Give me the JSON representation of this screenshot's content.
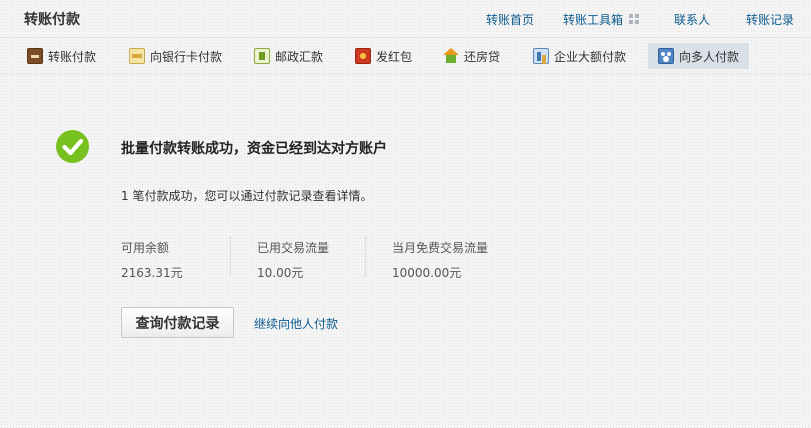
{
  "header": {
    "title": "转账付款",
    "links": {
      "home": "转账首页",
      "toolbox": "转账工具箱",
      "contacts": "联系人",
      "records": "转账记录"
    }
  },
  "tabs": [
    {
      "label": "转账付款",
      "icon": "transfer-icon"
    },
    {
      "label": "向银行卡付款",
      "icon": "bank-card-icon"
    },
    {
      "label": "邮政汇款",
      "icon": "postal-icon"
    },
    {
      "label": "发红包",
      "icon": "red-packet-icon"
    },
    {
      "label": "还房贷",
      "icon": "house-icon"
    },
    {
      "label": "企业大额付款",
      "icon": "enterprise-icon"
    },
    {
      "label": "向多人付款",
      "icon": "multi-payee-icon",
      "active": true
    }
  ],
  "result": {
    "title": "批量付款转账成功，资金已经到达对方账户",
    "detail": "1 笔付款成功，您可以通过付款记录查看详情。"
  },
  "stats": [
    {
      "label": "可用余额",
      "value": "2163.31元"
    },
    {
      "label": "已用交易流量",
      "value": "10.00元"
    },
    {
      "label": "当月免费交易流量",
      "value": "10000.00元"
    }
  ],
  "actions": {
    "primary": "查询付款记录",
    "secondary": "继续向他人付款"
  },
  "colors": {
    "link": "#0e5c8f",
    "success": "#77c11e",
    "active_tab": "#d9e0e7"
  }
}
